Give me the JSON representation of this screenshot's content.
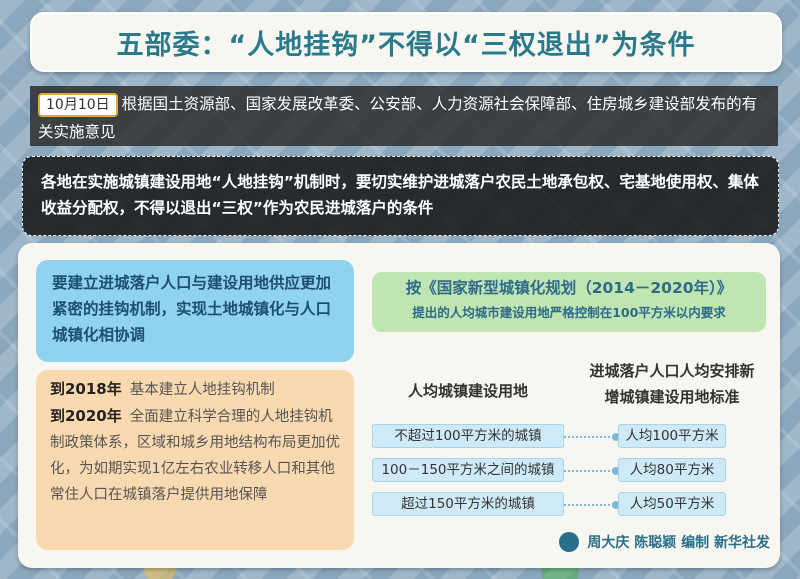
{
  "title": "五部委：“人地挂钩”不得以“三权退出”为条件",
  "intro": {
    "date": "10月10日",
    "text": "根据国土资源部、国家发展改革委、公安部、人力资源社会保障部、住房城乡建设部发布的有关实施意见"
  },
  "main_statement": "各地在实施城镇建设用地“人地挂钩”机制时，要切实维护进城落户农民土地承包权、宅基地使用权、集体收益分配权，不得以退出“三权”作为农民进城落户的条件",
  "requirement": "要建立进城落户人口与建设用地供应更加紧密的挂钩机制，实现土地城镇化与人口城镇化相协调",
  "timeline": [
    {
      "year": "到2018年",
      "text": "基本建立人地挂钩机制"
    },
    {
      "year": "到2020年",
      "text": "全面建立科学合理的人地挂钩机制政策体系，区域和城乡用地结构布局更加优化，为如期实现1亿左右农业转移人口和其他常住人口在城镇落户提供用地保障"
    }
  ],
  "plan": {
    "line1": "按《国家新型城镇化规划（2014－2020年）》",
    "line2": "提出的人均城市建设用地严格控制在100平方米以内要求"
  },
  "table": {
    "left_header": "人均城镇建设用地",
    "right_header": "进城落户人口人均安排新增城镇建设用地标准",
    "rows": [
      {
        "left": "不超过100平方米的城镇",
        "right": "人均100平方米"
      },
      {
        "left": "100－150平方米之间的城镇",
        "right": "人均80平方米"
      },
      {
        "left": "超过150平方米的城镇",
        "right": "人均50平方米"
      }
    ]
  },
  "credit": "周大庆 陈聪颖 编制 新华社发"
}
